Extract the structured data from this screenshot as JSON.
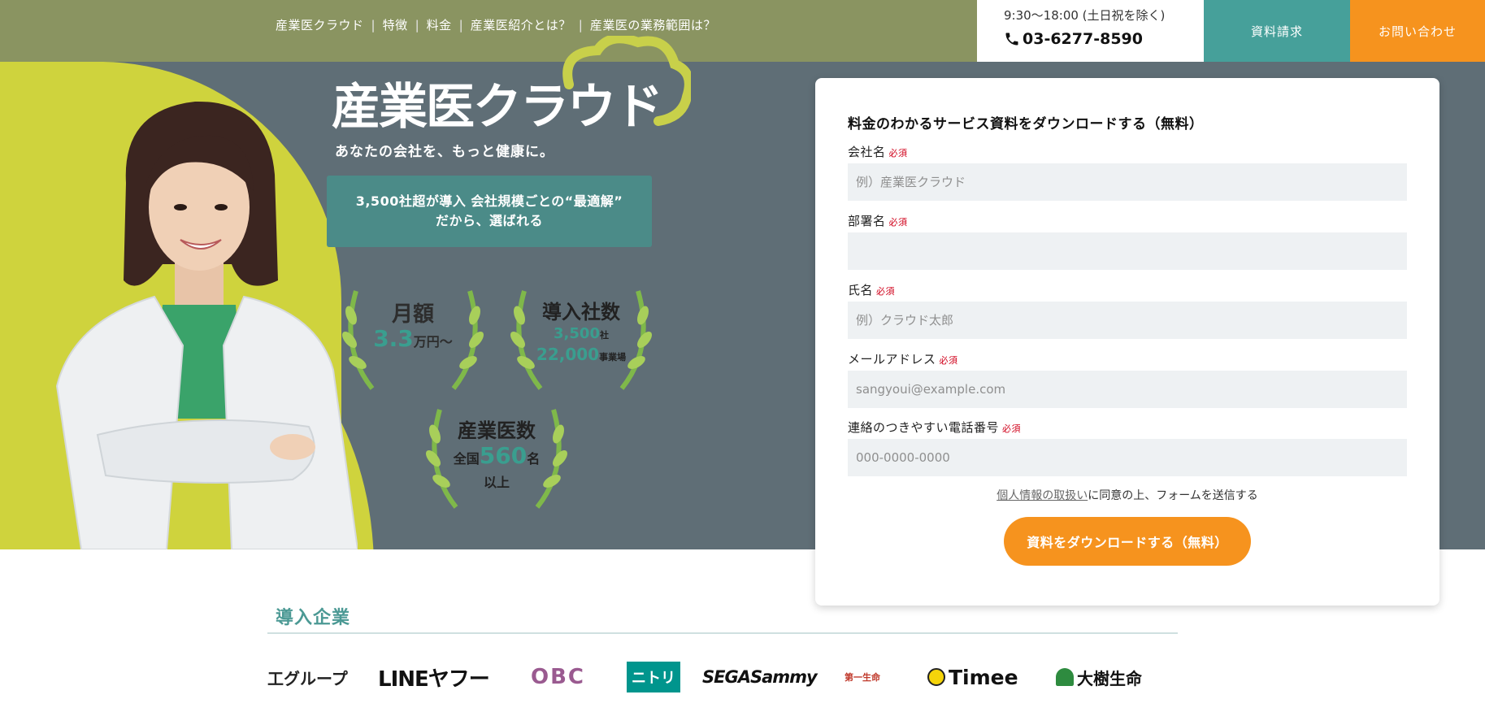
{
  "nav": {
    "links": [
      "産業医クラウド",
      "特徴",
      "料金",
      "産業医紹介とは？",
      "産業医の業務範囲は？"
    ]
  },
  "contact": {
    "hours": "9:30〜18:00 (土日祝を除く)",
    "phone": "03-6277-8590",
    "request_label": "資料請求",
    "inquiry_label": "お問い合わせ"
  },
  "hero": {
    "logo_text": "産業医クラウド",
    "tagline": "あなたの会社を、もっと健康に。",
    "headline_line1": "3,500社超が導入 会社規模ごとの“最適解”",
    "headline_line2": "だから、選ばれる",
    "badges": {
      "price": {
        "title": "月額",
        "value": "3.3",
        "unit": "万円〜"
      },
      "adoption": {
        "title": "導入社数",
        "companies": "3,500",
        "companies_unit": "社",
        "sites": "22,000",
        "sites_unit": "事業場"
      },
      "doctors": {
        "title": "産業医数",
        "prefix": "全国",
        "value": "560",
        "unit": "名",
        "suffix": "以上"
      }
    }
  },
  "form": {
    "title": "料金のわかるサービス資料をダウンロードする（無料）",
    "required_mark": "必須",
    "fields": [
      {
        "label": "会社名",
        "placeholder": "例）産業医クラウド"
      },
      {
        "label": "部署名",
        "placeholder": ""
      },
      {
        "label": "氏名",
        "placeholder": "例）クラウド太郎"
      },
      {
        "label": "メールアドレス",
        "placeholder": "sangyoui@example.com"
      },
      {
        "label": "連絡のつきやすい電話番号",
        "placeholder": "000-0000-0000"
      }
    ],
    "privacy_link": "個人情報の取扱い",
    "privacy_text": "に同意の上、フォームを送信する",
    "submit_label": "資料をダウンロードする（無料）"
  },
  "companies": {
    "title": "導入企業",
    "logos": [
      "工グループ",
      "LINEヤフー",
      "OBC",
      "ニトリ",
      "SEGASammy",
      "第一生命",
      "Timee",
      "大樹生命"
    ]
  },
  "colors": {
    "hero_bg": "#5f6e76",
    "olive": "#8a9461",
    "lime": "#cfd33d",
    "teal": "#46a09a",
    "orange": "#f6931e"
  }
}
